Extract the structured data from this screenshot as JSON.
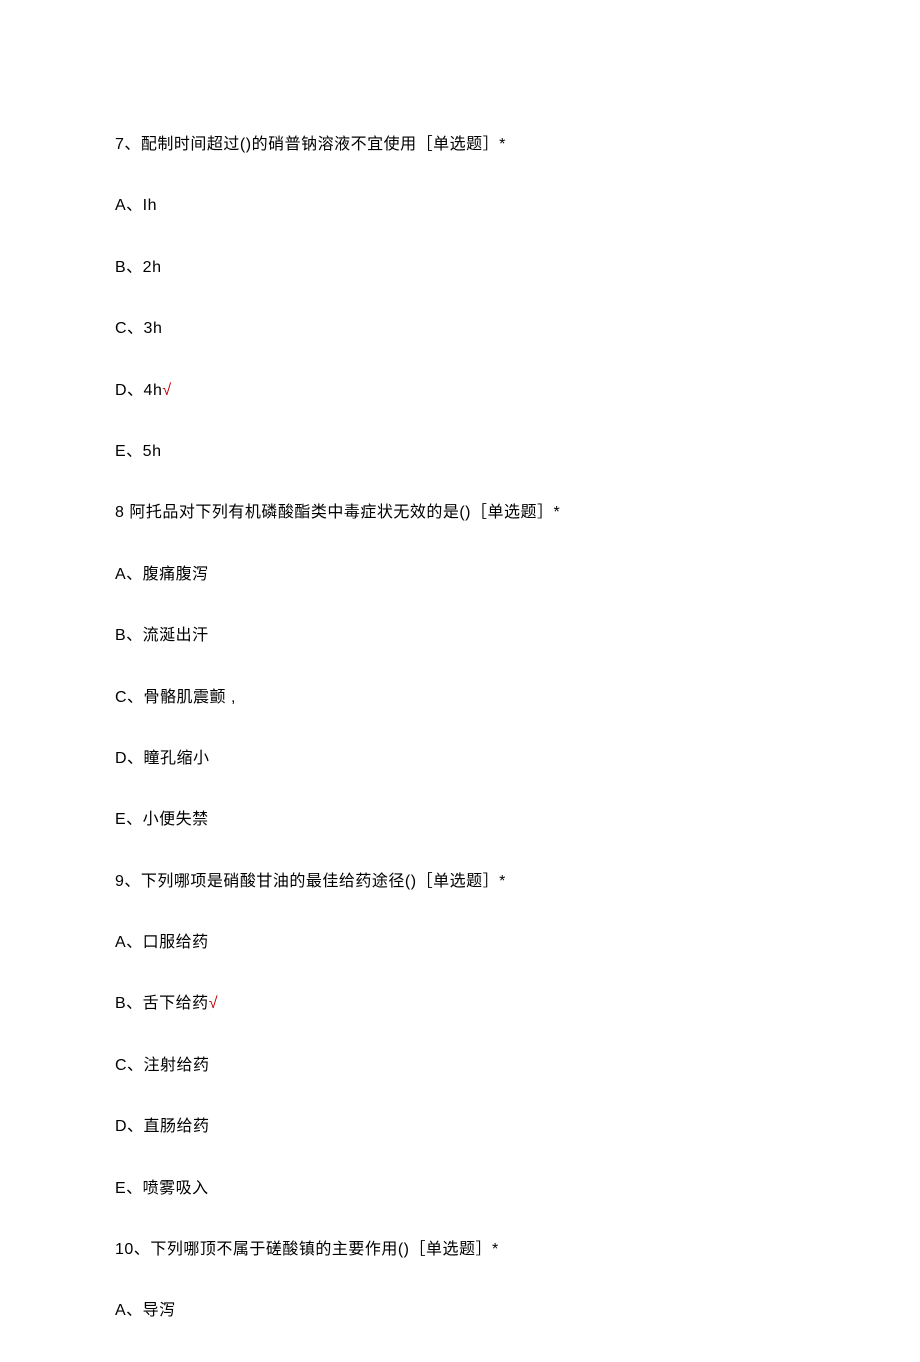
{
  "questions": [
    {
      "number": "7、",
      "text": "配制时间超过()的硝普钠溶液不宜使用［单选题］*",
      "options": [
        {
          "label": "A、Ih",
          "correct": false
        },
        {
          "label": "B、2h",
          "correct": false
        },
        {
          "label": "C、3h",
          "correct": false
        },
        {
          "label": "D、4h",
          "correct": true
        },
        {
          "label": "E、5h",
          "correct": false
        }
      ]
    },
    {
      "number": "8 ",
      "text": "阿托品对下列有机磷酸酯类中毒症状无效的是()［单选题］*",
      "options": [
        {
          "label": "A、腹痛腹泻",
          "correct": false
        },
        {
          "label": "B、流涎出汗",
          "correct": false
        },
        {
          "label": "C、骨骼肌震颤 ,",
          "correct": false
        },
        {
          "label": "D、瞳孔缩小",
          "correct": false
        },
        {
          "label": "E、小便失禁",
          "correct": false
        }
      ]
    },
    {
      "number": "9、",
      "text": "下列哪项是硝酸甘油的最佳给药途径()［单选题］*",
      "options": [
        {
          "label": "A、口服给药",
          "correct": false
        },
        {
          "label": "B、舌下给药",
          "correct": true
        },
        {
          "label": "C、注射给药",
          "correct": false
        },
        {
          "label": "D、直肠给药",
          "correct": false
        },
        {
          "label": "E、喷雾吸入",
          "correct": false
        }
      ]
    },
    {
      "number": "10、",
      "text": "下列哪顶不属于磋酸镇的主要作用()［单选题］*",
      "options": [
        {
          "label": "A、导泻",
          "correct": false
        }
      ]
    }
  ],
  "correct_symbol": "√"
}
